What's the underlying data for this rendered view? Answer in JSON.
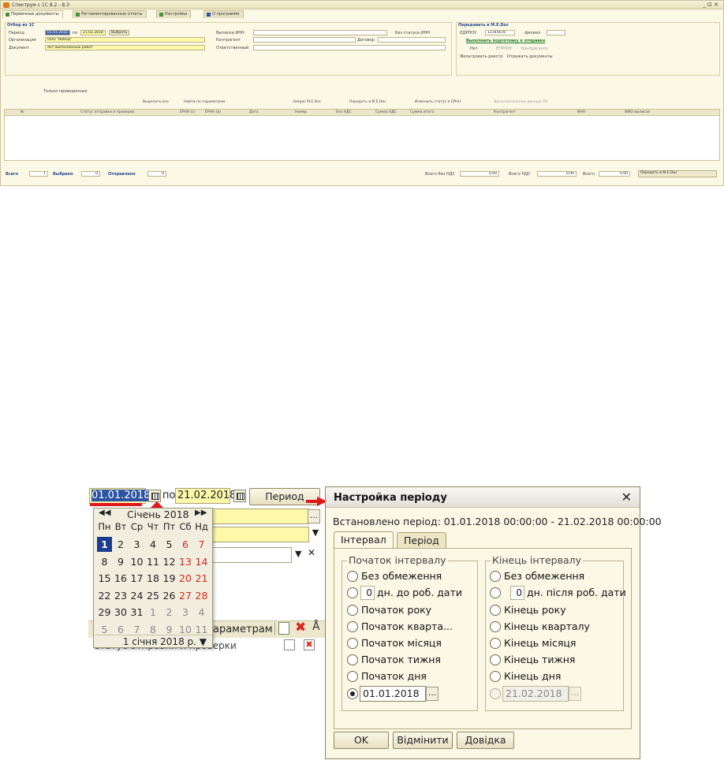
{
  "main_window": {
    "title": "Спектрум с 1С 8.2 - 8.3",
    "controls": "_ ⊡ ✕",
    "tabs": [
      "Первичные документы",
      "Регламентированные отчеты",
      "Настройки",
      "О программе"
    ],
    "filter": {
      "group_title": "Отбор из 1С",
      "period_label": "Период",
      "period_from": "01.01.2018",
      "period_to_label": "по",
      "period_to": "21.02.2018",
      "period_button": "Выбрать",
      "org_label": "Организация",
      "org_value": "ООО \"ВеКод\"",
      "doc_label": "Документ",
      "doc_value": "Акт выполненных работ",
      "inn_label": "Выписки ИНН",
      "contractor_label": "Контрагент",
      "contract_label": "Договор",
      "responsible_label": "Ответственный",
      "no_inn_label": "Без статуса ИНН"
    },
    "send": {
      "group_title": "Передавать в M.E.Doc",
      "edrpou_label": "ЄДРПОУ",
      "edrpou_value": "12345678",
      "branch_label": "филиал",
      "sign_link": "Выполнить подготовку к отправке",
      "opt_no": "Нет",
      "opt_fe": "ЕГРПОУ",
      "opt_contractor": "Контрагенту",
      "check_register": "Фильтровать реестр",
      "check_docs": "Отражать документы"
    },
    "only_posted": "Только проведенные",
    "grid_toolbar": [
      "Выделить все",
      "Найти по параметрам",
      "Запрос M.E.Doc",
      "Передать в M.E.Doc",
      "Изменить статус в ЕРНН",
      "Дополнительные данные ПН"
    ],
    "grid_columns": [
      "№",
      "Статус отправки и проверки",
      "ЕРНН (с)",
      "ЕРНН (в)",
      "Дата",
      "Номер",
      "Без НДС",
      "Сумма НДС",
      "Сумма итого",
      "Контрагент",
      "ИНН",
      "ФИО выписал"
    ],
    "footer": {
      "total_label": "Всего",
      "total_value": "1",
      "selected_label": "Выбрано",
      "selected_value": "0",
      "sent_label": "Отправлено",
      "sent_value": "0",
      "sum_no_vat_label": "Всего без НДС",
      "sum_no_vat": "0.00",
      "vat_label": "Всего НДС",
      "vat": "0.00",
      "total_sum_label": "Всего",
      "total_sum": "0.00",
      "button": "Передать в M.E.Doc"
    }
  },
  "zoom": {
    "period_from": "01.01.2018",
    "to_label": "по",
    "period_to": "21.02.2018",
    "period_button": "Период",
    "side_text": "араметрам",
    "status_text": "Статус отправки и проверки",
    "calendar": {
      "prev": "◀◀",
      "month": "Січень 2018",
      "next": "▶▶",
      "weekdays": [
        "Пн",
        "Вт",
        "Ср",
        "Чт",
        "Пт",
        "Сб",
        "Нд"
      ],
      "weeks": [
        [
          "1",
          "2",
          "3",
          "4",
          "5",
          "6",
          "7"
        ],
        [
          "8",
          "9",
          "10",
          "11",
          "12",
          "13",
          "14"
        ],
        [
          "15",
          "16",
          "17",
          "18",
          "19",
          "20",
          "21"
        ],
        [
          "22",
          "23",
          "24",
          "25",
          "26",
          "27",
          "28"
        ],
        [
          "29",
          "30",
          "31",
          "1",
          "2",
          "3",
          "4"
        ],
        [
          "5",
          "6",
          "7",
          "8",
          "9",
          "10",
          "11"
        ]
      ],
      "footer": "1 січня 2018 р. ▼"
    }
  },
  "dialog": {
    "title": "Настройка періоду",
    "close": "✕",
    "installed": "Встановлено період: 01.01.2018 00:00:00 - 21.02.2018 00:00:00",
    "tabs": [
      "Інтервал",
      "Період"
    ],
    "start": {
      "legend": "Початок інтервалу",
      "options": [
        "Без обмеження",
        "дн. до роб. дати",
        "Початок року",
        "Початок кварта...",
        "Початок місяця",
        "Початок тижня",
        "Початок дня"
      ],
      "days_value": "0",
      "date_value": "01.01.2018"
    },
    "end": {
      "legend": "Кінець інтервалу",
      "options": [
        "Без обмеження",
        "дн. після роб. дати",
        "Кінець року",
        "Кінець кварталу",
        "Кінець місяця",
        "Кінець тижня",
        "Кінець дня"
      ],
      "days_value": "0",
      "date_value": "21.02.2018"
    },
    "buttons": {
      "ok": "OK",
      "cancel": "Відмінити",
      "help": "Довідка"
    }
  },
  "colors": {
    "accent_red": "#e0181c",
    "selection_blue": "#2b53a3",
    "field_yellow": "#fdf9a8",
    "panel": "#fbf8e6"
  }
}
